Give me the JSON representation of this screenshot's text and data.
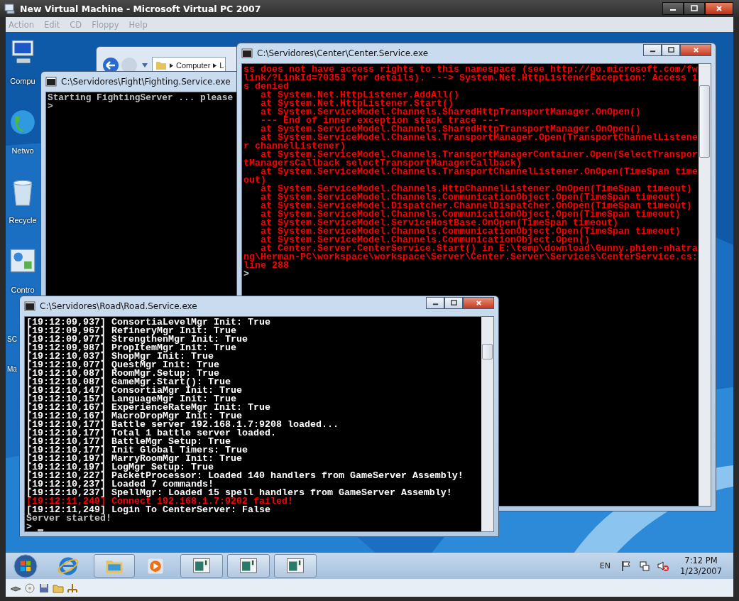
{
  "window": {
    "title": "New Virtual Machine - Microsoft Virtual PC 2007"
  },
  "menu": [
    "Action",
    "Edit",
    "CD",
    "Floppy",
    "Help"
  ],
  "desktop_icons": [
    {
      "kind": "computer",
      "lines": [
        "Compu"
      ]
    },
    {
      "kind": "network",
      "lines": [
        "Netwo"
      ]
    },
    {
      "kind": "recycle",
      "lines": [
        "Recycle"
      ]
    },
    {
      "kind": "control",
      "lines": [
        "Contro"
      ]
    },
    {
      "kind": "folder",
      "lines": [
        "SC",
        "Ma"
      ]
    }
  ],
  "explorer": {
    "breadcrumb": [
      "Computer",
      "L"
    ]
  },
  "consoles": [
    {
      "title": "C:\\Servidores\\Fight\\Fighting.Service.exe",
      "cursor": false,
      "lines": [
        {
          "text": "Starting FightingServer ... please",
          "color": "#c0c0c0"
        },
        {
          "text": ">",
          "color": "#c0c0c0"
        }
      ]
    },
    {
      "title": "C:\\Servidores\\Center\\Center.Service.exe",
      "cursor": false,
      "lines": [
        {
          "text": "ss does not have access rights to this namespace (see http://go.microsoft.com/fw",
          "color": "#ff0000"
        },
        {
          "text": "link/?LinkId=70353 for details). ---> System.Net.HttpListenerException: Access i",
          "color": "#ff0000"
        },
        {
          "text": "s denied",
          "color": "#ff0000"
        },
        {
          "text": "   at System.Net.HttpListener.AddAll()",
          "color": "#ff0000"
        },
        {
          "text": "   at System.Net.HttpListener.Start()",
          "color": "#ff0000"
        },
        {
          "text": "   at System.ServiceModel.Channels.SharedHttpTransportManager.OnOpen()",
          "color": "#ff0000"
        },
        {
          "text": "   --- End of inner exception stack trace ---",
          "color": "#ff0000"
        },
        {
          "text": "   at System.ServiceModel.Channels.SharedHttpTransportManager.OnOpen()",
          "color": "#ff0000"
        },
        {
          "text": "   at System.ServiceModel.Channels.TransportManager.Open(TransportChannelListene",
          "color": "#ff0000"
        },
        {
          "text": "r channelListener)",
          "color": "#ff0000"
        },
        {
          "text": "   at System.ServiceModel.Channels.TransportManagerContainer.Open(SelectTranspor",
          "color": "#ff0000"
        },
        {
          "text": "tManagersCallback selectTransportManagerCallback)",
          "color": "#ff0000"
        },
        {
          "text": "   at System.ServiceModel.Channels.TransportChannelListener.OnOpen(TimeSpan time",
          "color": "#ff0000"
        },
        {
          "text": "out)",
          "color": "#ff0000"
        },
        {
          "text": "   at System.ServiceModel.Channels.HttpChannelListener.OnOpen(TimeSpan timeout)",
          "color": "#ff0000"
        },
        {
          "text": "   at System.ServiceModel.Channels.CommunicationObject.Open(TimeSpan timeout)",
          "color": "#ff0000"
        },
        {
          "text": "   at System.ServiceModel.Dispatcher.ChannelDispatcher.OnOpen(TimeSpan timeout)",
          "color": "#ff0000"
        },
        {
          "text": "   at System.ServiceModel.Channels.CommunicationObject.Open(TimeSpan timeout)",
          "color": "#ff0000"
        },
        {
          "text": "   at System.ServiceModel.ServiceHostBase.OnOpen(TimeSpan timeout)",
          "color": "#ff0000"
        },
        {
          "text": "   at System.ServiceModel.Channels.CommunicationObject.Open(TimeSpan timeout)",
          "color": "#ff0000"
        },
        {
          "text": "   at System.ServiceModel.Channels.CommunicationObject.Open()",
          "color": "#ff0000"
        },
        {
          "text": "   at Center.Server.CenterService.Start() in E:\\temp\\download\\Gunny.phien-nhatra",
          "color": "#ff0000"
        },
        {
          "text": "ng\\Herman-PC\\workspace\\workspace\\Server\\Center.Server\\Services\\CenterService.cs:",
          "color": "#ff0000"
        },
        {
          "text": "line 288",
          "color": "#ff0000"
        },
        {
          "text": ">",
          "color": "#c0c0c0"
        }
      ]
    },
    {
      "title": "C:\\Servidores\\Road\\Road.Service.exe",
      "cursor": true,
      "lines": [
        {
          "text": "[19:12:09,937] ConsortiaLevelMgr Init: True",
          "color": "#ffffff"
        },
        {
          "text": "[19:12:09,967] RefineryMgr Init: True",
          "color": "#ffffff"
        },
        {
          "text": "[19:12:09,977] StrengthenMgr Init: True",
          "color": "#ffffff"
        },
        {
          "text": "[19:12:09,987] PropItemMgr Init: True",
          "color": "#ffffff"
        },
        {
          "text": "[19:12:10,037] ShopMgr Init: True",
          "color": "#ffffff"
        },
        {
          "text": "[19:12:10,077] QuestMgr Init: True",
          "color": "#ffffff"
        },
        {
          "text": "[19:12:10,087] RoomMgr.Setup: True",
          "color": "#ffffff"
        },
        {
          "text": "[19:12:10,087] GameMgr.Start(): True",
          "color": "#ffffff"
        },
        {
          "text": "[19:12:10,147] ConsortiaMgr Init: True",
          "color": "#ffffff"
        },
        {
          "text": "[19:12:10,157] LanguageMgr Init: True",
          "color": "#ffffff"
        },
        {
          "text": "[19:12:10,167] ExperienceRateMgr Init: True",
          "color": "#ffffff"
        },
        {
          "text": "[19:12:10,167] MacroDropMgr Init: True",
          "color": "#ffffff"
        },
        {
          "text": "[19:12:10,177] Battle server 192.168.1.7:9208 loaded...",
          "color": "#ffffff"
        },
        {
          "text": "[19:12:10,177] Total 1 battle server loaded.",
          "color": "#ffffff"
        },
        {
          "text": "[19:12:10,177] BattleMgr Setup: True",
          "color": "#ffffff"
        },
        {
          "text": "[19:12:10,177] Init Global Timers: True",
          "color": "#ffffff"
        },
        {
          "text": "[19:12:10,197] MarryRoomMgr Init: True",
          "color": "#ffffff"
        },
        {
          "text": "[19:12:10,197] LogMgr Setup: True",
          "color": "#ffffff"
        },
        {
          "text": "[19:12:10,227] PacketProcessor: Loaded 140 handlers from GameServer Assembly!",
          "color": "#ffffff"
        },
        {
          "text": "[19:12:10,237] Loaded 7 commands!",
          "color": "#ffffff"
        },
        {
          "text": "[19:12:10,237] SpellMgr: Loaded 15 spell handlers from GameServer Assembly!",
          "color": "#ffffff"
        },
        {
          "text": "[19:12:11,249] Connect 192.168.1.7:9202 failed!",
          "color": "#ff0000"
        },
        {
          "text": "[19:12:11,249] Login To CenterServer: False",
          "color": "#ffffff"
        },
        {
          "text": "Server started!",
          "color": "#c0c0c0"
        },
        {
          "text": ">",
          "color": "#c0c0c0"
        }
      ]
    }
  ],
  "taskbar": {
    "items": [
      {
        "kind": "browser"
      },
      {
        "kind": "folder"
      },
      {
        "kind": "media"
      },
      {
        "kind": "console"
      },
      {
        "kind": "console"
      },
      {
        "kind": "console"
      }
    ],
    "language": "EN",
    "time": "7:12 PM",
    "date": "1/23/2007"
  }
}
